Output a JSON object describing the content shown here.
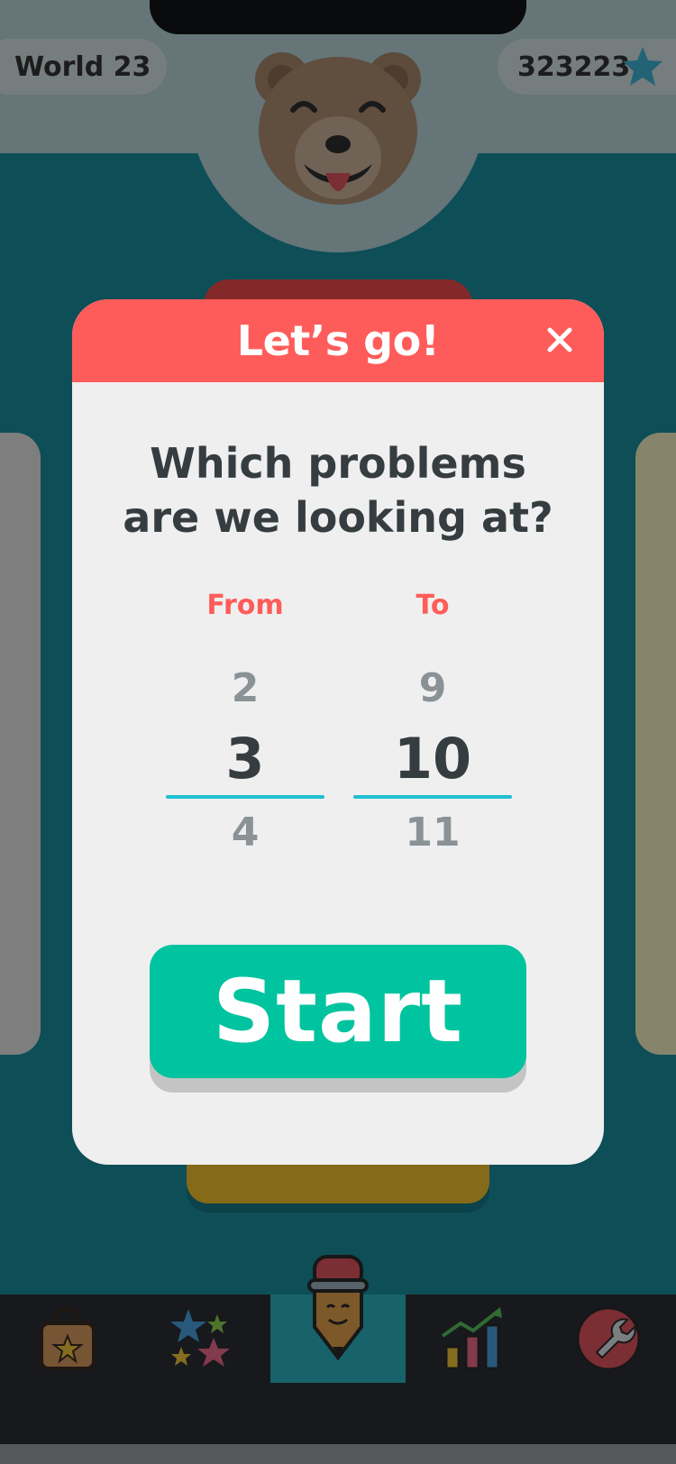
{
  "header": {
    "world_label": "World 23",
    "score": "323223"
  },
  "modal": {
    "title": "Let’s go!",
    "close_icon": "close-icon",
    "question": "Which problems are we looking at?",
    "from": {
      "label": "From",
      "prev": "2",
      "current": "3",
      "next": "4"
    },
    "to": {
      "label": "To",
      "prev": "9",
      "current": "10",
      "next": "11"
    },
    "start_label": "Start"
  },
  "tabbar": {
    "items": [
      {
        "icon": "shopping-bag-icon",
        "active": false
      },
      {
        "icon": "stars-icon",
        "active": false
      },
      {
        "icon": "pencil-character-icon",
        "active": true
      },
      {
        "icon": "chart-icon",
        "active": false
      },
      {
        "icon": "wrench-icon",
        "active": false
      }
    ]
  },
  "colors": {
    "header_red": "#fe5c5a",
    "start_green": "#00c39f",
    "underline_cyan": "#1fbfd0",
    "background_teal": "#1b8e9e"
  }
}
